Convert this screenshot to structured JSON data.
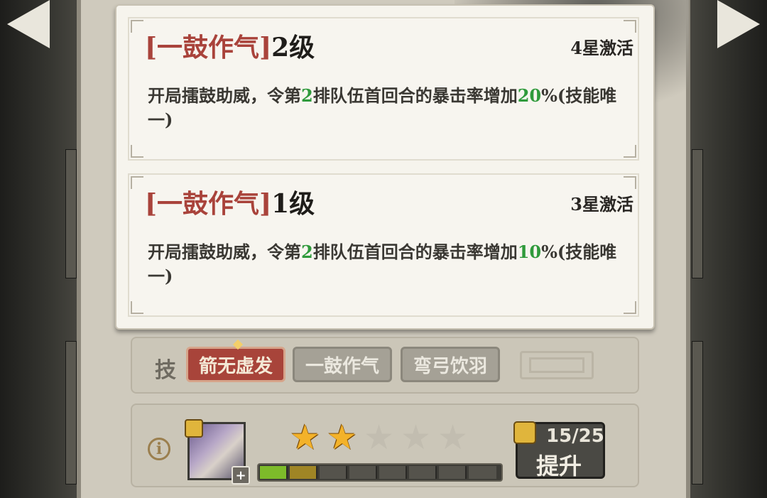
{
  "tooltip": {
    "cards": [
      {
        "title_bracket_open": "[",
        "title_name": "一鼓作气",
        "title_bracket_close": "]",
        "level": "2级",
        "activation": "4星激活",
        "desc_pre": "开局擂鼓助威，令第",
        "desc_num": "2",
        "desc_mid": "排队伍首回合的暴击率增加",
        "desc_val": "20",
        "desc_post": "%(技能唯一)"
      },
      {
        "title_bracket_open": "[",
        "title_name": "一鼓作气",
        "title_bracket_close": "]",
        "level": "1级",
        "activation": "3星激活",
        "desc_pre": "开局擂鼓助威，令第",
        "desc_num": "2",
        "desc_mid": "排队伍首回合的暴击率增加",
        "desc_val": "10",
        "desc_post": "%(技能唯一)"
      }
    ]
  },
  "skills": {
    "label": "技",
    "tabs": [
      "箭无虚发",
      "一鼓作气",
      "弯弓饮羽"
    ],
    "active_index": 0
  },
  "upgrade": {
    "info_icon": "i",
    "avatar_plus": "+",
    "stars_total": 5,
    "stars_lit": 2,
    "progress_segments": 8,
    "progress_filled_green": 1,
    "progress_filled_gold": 1,
    "count": "15/25",
    "button_label": "提升"
  },
  "colors": {
    "accent_red": "#a8443a",
    "value_green": "#2f9a3b",
    "star_gold": "#f3b22a"
  }
}
